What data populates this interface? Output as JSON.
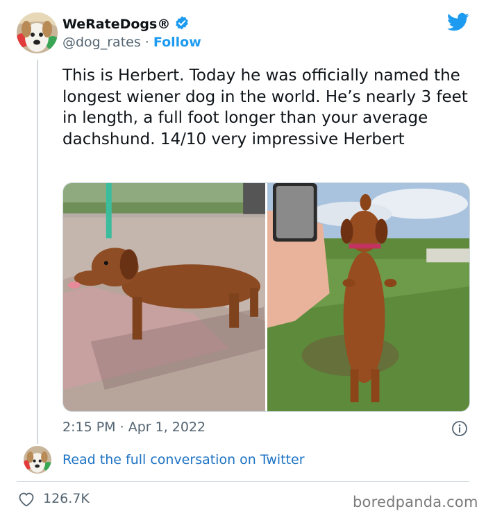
{
  "account": {
    "name": "WeRateDogs®",
    "handle": "@dog_rates",
    "separator": "·",
    "follow_label": "Follow",
    "avatar_icon": "dog-avatar",
    "verified_icon": "verified-badge-icon"
  },
  "platform": {
    "icon": "twitter-bird-icon",
    "color": "#1d9bf0"
  },
  "tweet": {
    "text": "This is Herbert. Today he was officially named the longest wiener dog in the world. He’s nearly 3 feet in length, a full foot longer than your average dachshund. 14/10 very impressive Herbert",
    "photos": [
      {
        "icon": "dachshund-standing-photo"
      },
      {
        "icon": "dachshund-upright-photo"
      }
    ],
    "time": "2:15 PM",
    "date": "Apr 1, 2022",
    "meta_separator": "·"
  },
  "conversation": {
    "link_label": "Read the full conversation on Twitter"
  },
  "engagement": {
    "likes": "126.7K",
    "like_icon": "heart-icon"
  },
  "watermark": "boredpanda.com",
  "colors": {
    "link": "#1d9bf0",
    "secondary_text": "#536471",
    "divider": "#cfd9de"
  }
}
